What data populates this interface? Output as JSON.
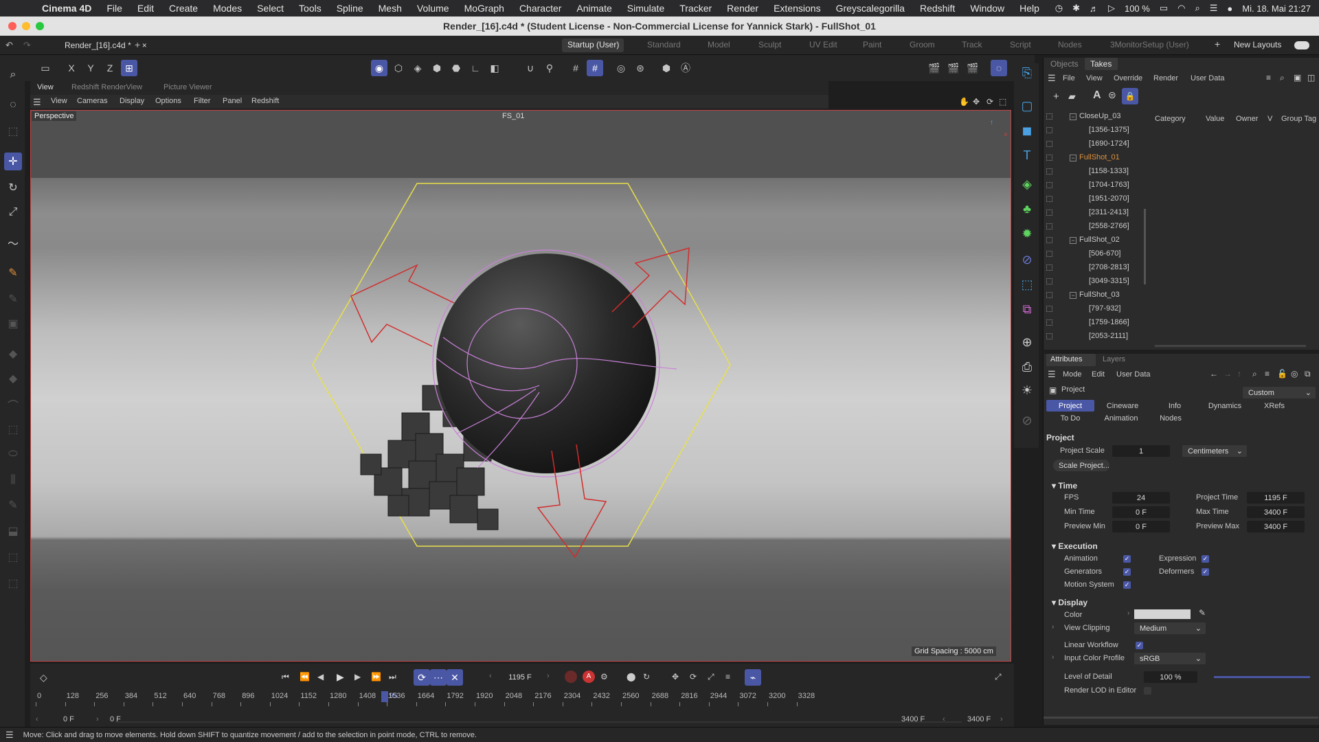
{
  "menubar": {
    "app": "Cinema 4D",
    "items": [
      "File",
      "Edit",
      "Create",
      "Modes",
      "Select",
      "Tools",
      "Spline",
      "Mesh",
      "Volume",
      "MoGraph",
      "Character",
      "Animate",
      "Simulate",
      "Tracker",
      "Render",
      "Extensions",
      "Greyscalegorilla",
      "Redshift",
      "Window",
      "Help"
    ],
    "battery": "100 %",
    "datetime": "Mi. 18. Mai  21:27"
  },
  "window": {
    "title": "Render_[16].c4d * (Student License - Non-Commercial License for Yannick Stark) - FullShot_01"
  },
  "layout_bar": {
    "doc_tab": "Render_[16].c4d *",
    "layouts": [
      "Startup (User)",
      "Standard",
      "Model",
      "Sculpt",
      "UV Edit",
      "Paint",
      "Groom",
      "Track",
      "Script",
      "Nodes",
      "3MonitorSetup (User)"
    ],
    "active_layout": "Startup (User)",
    "new_layouts": "New Layouts"
  },
  "axis_buttons": [
    "X",
    "Y",
    "Z"
  ],
  "viewport": {
    "tabs": [
      "View",
      "Redshift RenderView",
      "Picture Viewer"
    ],
    "menu": [
      "View",
      "Cameras",
      "Display",
      "Options",
      "Filter",
      "Panel",
      "Redshift"
    ],
    "projection": "Perspective",
    "camera": "FS_01",
    "grid_spacing": "Grid Spacing : 5000 cm"
  },
  "objects_panel": {
    "tabs": [
      "Objects",
      "Takes"
    ],
    "active_tab": "Takes",
    "menu": [
      "File",
      "View",
      "Override",
      "Render",
      "User Data"
    ],
    "columns": [
      "Category",
      "Value",
      "Owner",
      "V",
      "Group Tag"
    ],
    "takes": [
      {
        "label": "CloseUp_03",
        "level": 0,
        "group": true,
        "active": false
      },
      {
        "label": "[1356-1375]",
        "level": 1,
        "group": false,
        "active": false
      },
      {
        "label": "[1690-1724]",
        "level": 1,
        "group": false,
        "active": false
      },
      {
        "label": "FullShot_01",
        "level": 0,
        "group": true,
        "active": true
      },
      {
        "label": "[1158-1333]",
        "level": 1,
        "group": false,
        "active": false
      },
      {
        "label": "[1704-1763]",
        "level": 1,
        "group": false,
        "active": false
      },
      {
        "label": "[1951-2070]",
        "level": 1,
        "group": false,
        "active": false
      },
      {
        "label": "[2311-2413]",
        "level": 1,
        "group": false,
        "active": false
      },
      {
        "label": "[2558-2766]",
        "level": 1,
        "group": false,
        "active": false
      },
      {
        "label": "FullShot_02",
        "level": 0,
        "group": true,
        "active": false
      },
      {
        "label": "[506-670]",
        "level": 1,
        "group": false,
        "active": false
      },
      {
        "label": "[2708-2813]",
        "level": 1,
        "group": false,
        "active": false
      },
      {
        "label": "[3049-3315]",
        "level": 1,
        "group": false,
        "active": false
      },
      {
        "label": "FullShot_03",
        "level": 0,
        "group": true,
        "active": false
      },
      {
        "label": "[797-932]",
        "level": 1,
        "group": false,
        "active": false
      },
      {
        "label": "[1759-1866]",
        "level": 1,
        "group": false,
        "active": false
      },
      {
        "label": "[2053-2111]",
        "level": 1,
        "group": false,
        "active": false
      }
    ]
  },
  "attributes": {
    "tabs": [
      "Attributes",
      "Layers"
    ],
    "menu": [
      "Mode",
      "Edit",
      "User Data"
    ],
    "object": "Project",
    "preset": "Custom",
    "subtabs_row1": [
      "Project",
      "Cineware",
      "Info",
      "Dynamics",
      "XRefs"
    ],
    "subtabs_row2": [
      "To Do",
      "Animation",
      "Nodes"
    ],
    "section_title": "Project",
    "project_scale_label": "Project Scale",
    "project_scale": "1",
    "scale_unit": "Centimeters",
    "scale_button": "Scale Project...",
    "time": {
      "title": "Time",
      "fps_label": "FPS",
      "fps": "24",
      "project_time_label": "Project Time",
      "project_time": "1195 F",
      "min_time_label": "Min Time",
      "min_time": "0 F",
      "max_time_label": "Max Time",
      "max_time": "3400 F",
      "preview_min_label": "Preview Min",
      "preview_min": "0 F",
      "preview_max_label": "Preview Max",
      "preview_max": "3400 F"
    },
    "execution": {
      "title": "Execution",
      "animation": "Animation",
      "expression": "Expression",
      "generators": "Generators",
      "deformers": "Deformers",
      "motion_system": "Motion System"
    },
    "display": {
      "title": "Display",
      "color_label": "Color",
      "view_clipping_label": "View Clipping",
      "view_clipping": "Medium",
      "linear_workflow": "Linear Workflow",
      "input_color_profile_label": "Input Color Profile",
      "input_color_profile": "sRGB",
      "level_of_detail_label": "Level of Detail",
      "level_of_detail": "100 %",
      "level_of_detail_fill": 1.0,
      "render_lod": "Render LOD in Editor"
    }
  },
  "timeline": {
    "current_frame": "1195 F",
    "ticks": [
      "0",
      "128",
      "256",
      "384",
      "512",
      "640",
      "768",
      "896",
      "1024",
      "1152",
      "1195",
      "1280",
      "1408",
      "1536",
      "1664",
      "1792",
      "1920",
      "2048",
      "2176",
      "2304",
      "2432",
      "2560",
      "2688",
      "2816",
      "2944",
      "3072",
      "3200",
      "3328"
    ],
    "start_frame": "0 F",
    "start_frame_2": "0 F",
    "end_frame": "3400 F",
    "end_frame_2": "3400 F"
  },
  "status": "Move: Click and drag to move elements. Hold down SHIFT to quantize movement / add to the selection in point mode, CTRL to remove.",
  "colors": {
    "accent": "#4a57a5",
    "active_take": "#e0913a",
    "viewport_border": "#c04545",
    "gizmo_hex": "#e8e04a",
    "gizmo_arrow": "#d22c2c",
    "spline": "#c982d8"
  }
}
